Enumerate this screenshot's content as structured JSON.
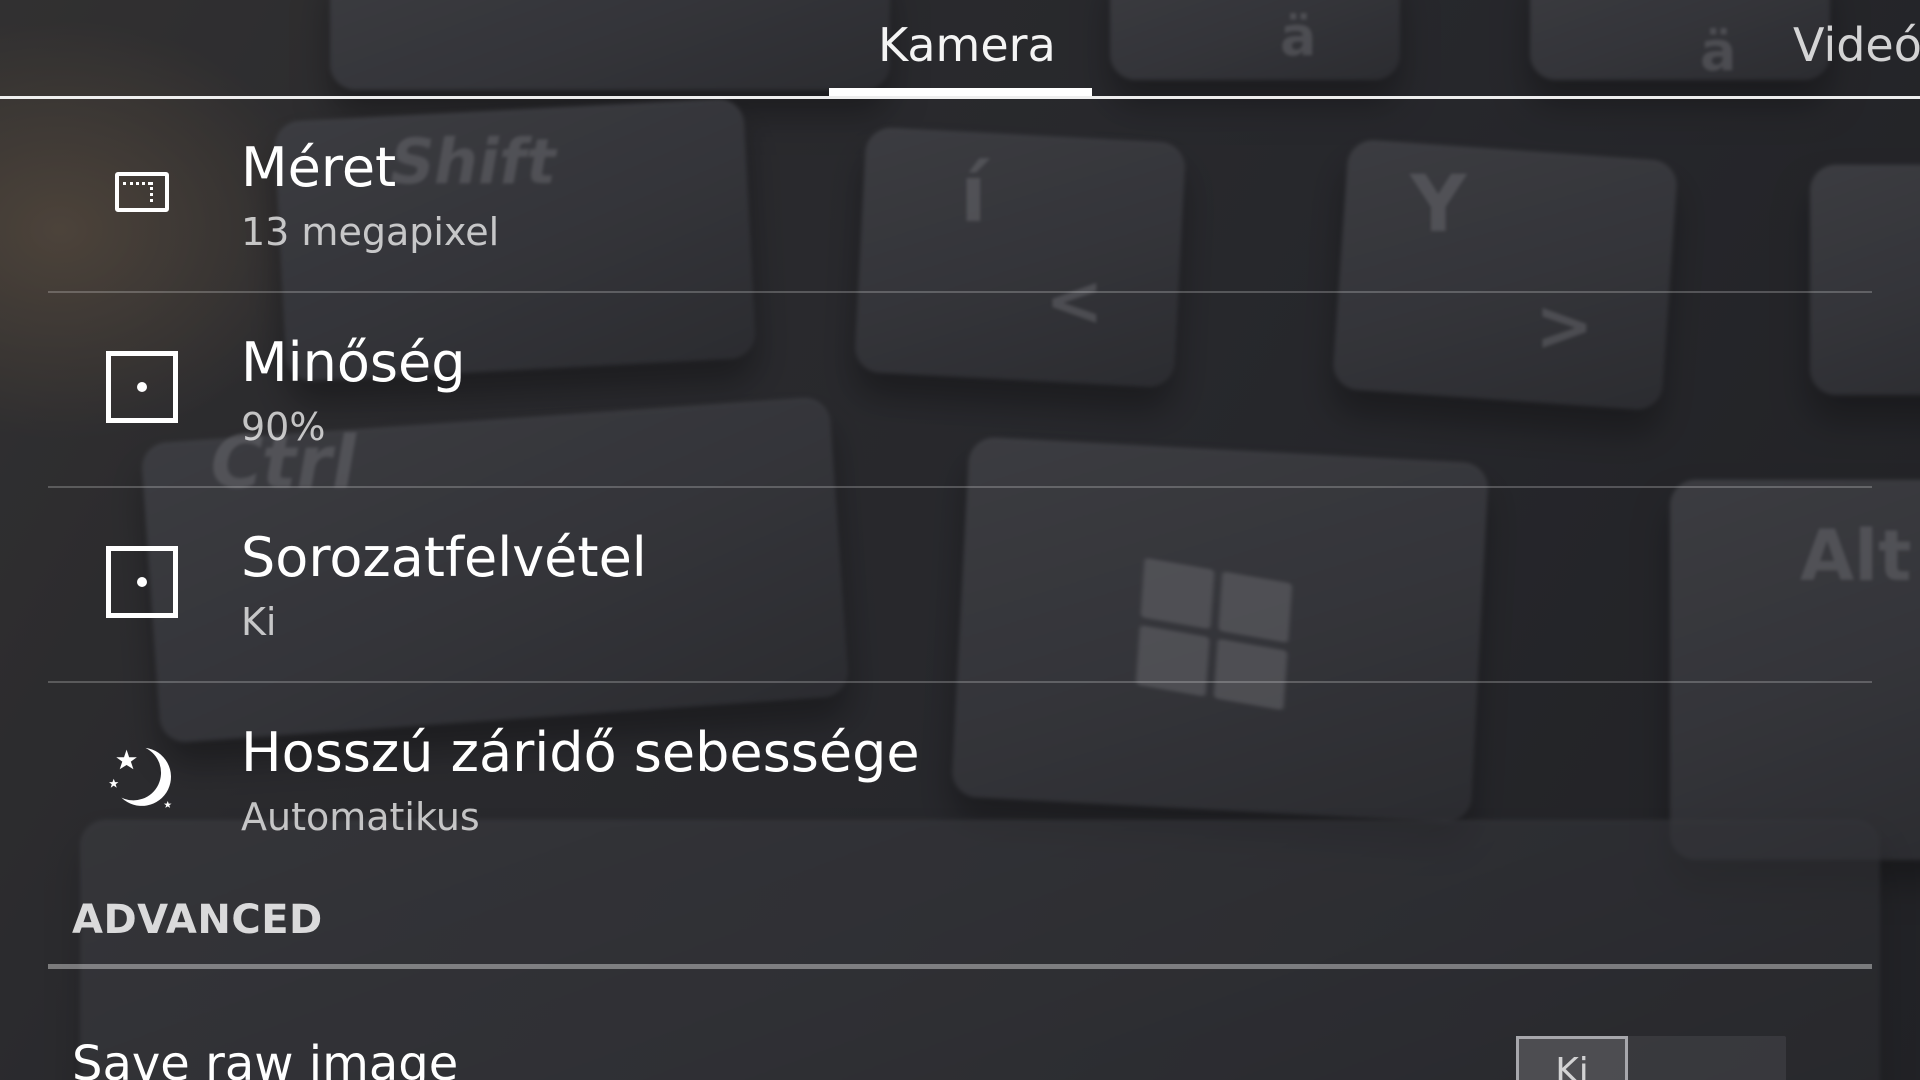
{
  "tabs": [
    {
      "label": "Kamera",
      "active": true
    },
    {
      "label": "Videó",
      "active": false
    }
  ],
  "settings": [
    {
      "icon": "picture-size-icon",
      "title": "Méret",
      "value": "13 megapixel"
    },
    {
      "icon": "quality-square-icon",
      "title": "Minőség",
      "value": "90%"
    },
    {
      "icon": "burst-square-icon",
      "title": "Sorozatfelvétel",
      "value": "Ki"
    },
    {
      "icon": "moon-stars-icon",
      "title": "Hosszú záridő sebessége",
      "value": "Automatikus"
    }
  ],
  "advanced": {
    "header": "ADVANCED",
    "save_raw": {
      "label": "Save raw image",
      "toggle_text": "Ki",
      "enabled": false
    }
  },
  "colors": {
    "text": "#ffffff",
    "subtext": "#b8b8b8",
    "divider": "#5a5a5e"
  }
}
